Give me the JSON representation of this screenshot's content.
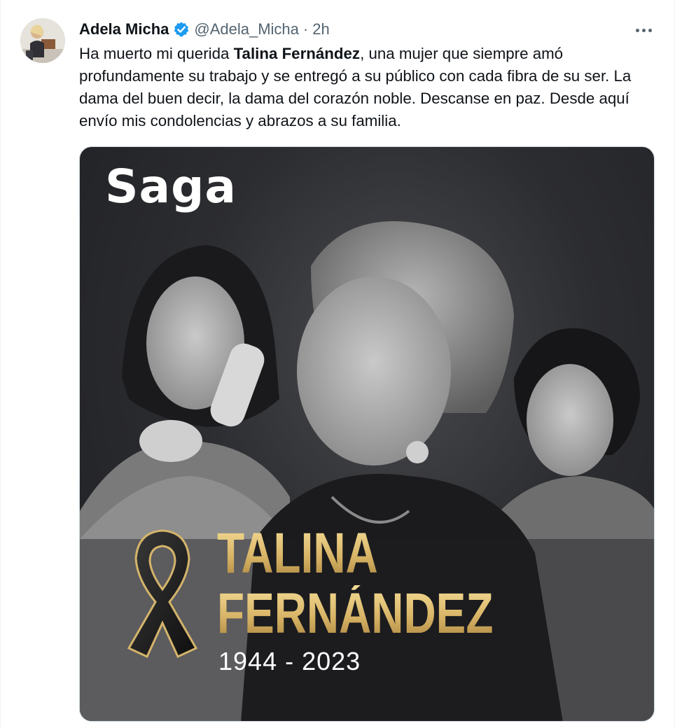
{
  "author": {
    "display_name": "Adela Micha",
    "handle": "@Adela_Micha",
    "separator": "·",
    "time": "2h",
    "verified": true,
    "verified_color": "#1d9bf0"
  },
  "icons": {
    "verified": "verified-badge-icon",
    "more": "more-options-icon",
    "ribbon": "mourning-ribbon-icon"
  },
  "tweet": {
    "text_pre": "Ha muerto mi querida ",
    "text_bold": "Talina Fernández",
    "text_post": ", una mujer que siempre amó profundamente su trabajo y se entregó a su público con cada fibra de su ser. La dama del buen decir, la dama del corazón noble. Descanse en paz. Desde aquí envío mis condolencias y abrazos a su familia."
  },
  "media": {
    "brand": "Saga",
    "title_line1": "TALINA",
    "title_line2": "FERNÁNDEZ",
    "years": "1944 - 2023",
    "gold_color": "#d4b46b"
  }
}
